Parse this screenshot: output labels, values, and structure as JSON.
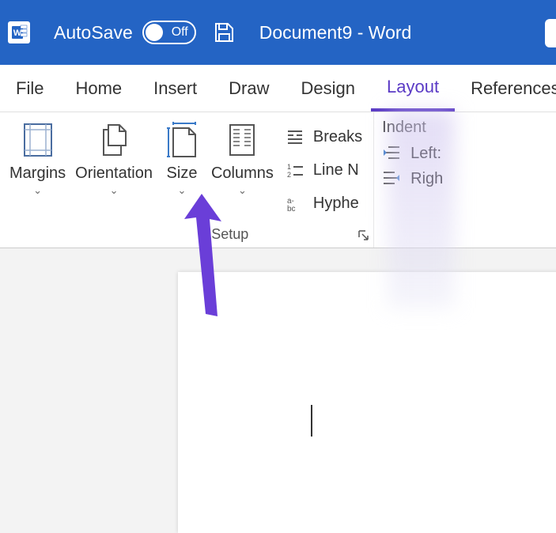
{
  "title_bar": {
    "autosave_label": "AutoSave",
    "toggle_state": "Off",
    "document_title": "Document9  -  Word"
  },
  "tabs": {
    "file": "File",
    "home": "Home",
    "insert": "Insert",
    "draw": "Draw",
    "design": "Design",
    "layout": "Layout",
    "references": "References"
  },
  "layout_ribbon": {
    "margins": "Margins",
    "orientation": "Orientation",
    "size": "Size",
    "columns": "Columns",
    "breaks": "Breaks",
    "line_numbers": "Line N",
    "hyphenation": "Hyphe",
    "page_setup_label": "e Setup",
    "indent": {
      "title": "Indent",
      "left": "Left:",
      "right": "Righ"
    }
  }
}
